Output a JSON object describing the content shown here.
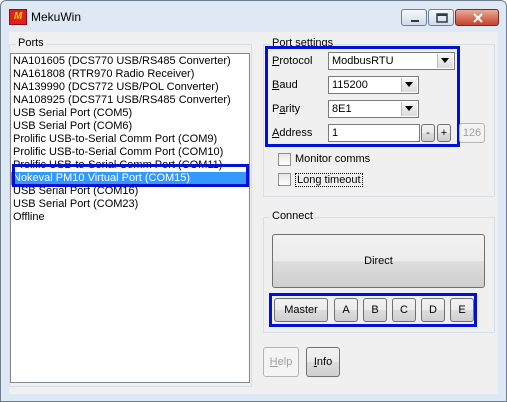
{
  "window": {
    "title": "MekuWin"
  },
  "ports": {
    "label": "Ports",
    "items": [
      "NA101605 (DCS770 USB/RS485 Converter)",
      "NA161808 (RTR970 Radio Receiver)",
      "NA139990 (DCS772 USB/POL Converter)",
      "NA108925 (DCS771 USB/RS485 Converter)",
      "USB Serial Port (COM5)",
      "USB Serial Port (COM6)",
      "Prolific USB-to-Serial Comm Port (COM9)",
      "Prolific USB-to-Serial Comm Port (COM10)",
      "Prolific USB-to-Serial Comm Port (COM11)",
      "Nokeval PM10 Virtual Port (COM15)",
      "USB Serial Port (COM16)",
      "USB Serial Port (COM23)",
      "Offline"
    ],
    "selected_index": 9
  },
  "port_settings": {
    "label": "Port settings",
    "protocol": {
      "label": "Protocol",
      "value": "ModbusRTU"
    },
    "baud": {
      "label": "Baud",
      "value": "115200"
    },
    "parity": {
      "label": "Parity",
      "value": "8E1"
    },
    "address": {
      "label": "Address",
      "value": "1",
      "minus": "-",
      "plus": "+",
      "max": "126"
    },
    "monitor_comms": {
      "label": "Monitor comms",
      "checked": false
    },
    "long_timeout": {
      "label": "Long timeout",
      "checked": false
    }
  },
  "connect": {
    "label": "Connect",
    "direct": "Direct",
    "master": "Master",
    "slots": [
      "A",
      "B",
      "C",
      "D",
      "E"
    ]
  },
  "buttons": {
    "help": "Help",
    "info": "Info"
  },
  "colors": {
    "highlight": "#0010d8",
    "selection": "#3399ff"
  }
}
